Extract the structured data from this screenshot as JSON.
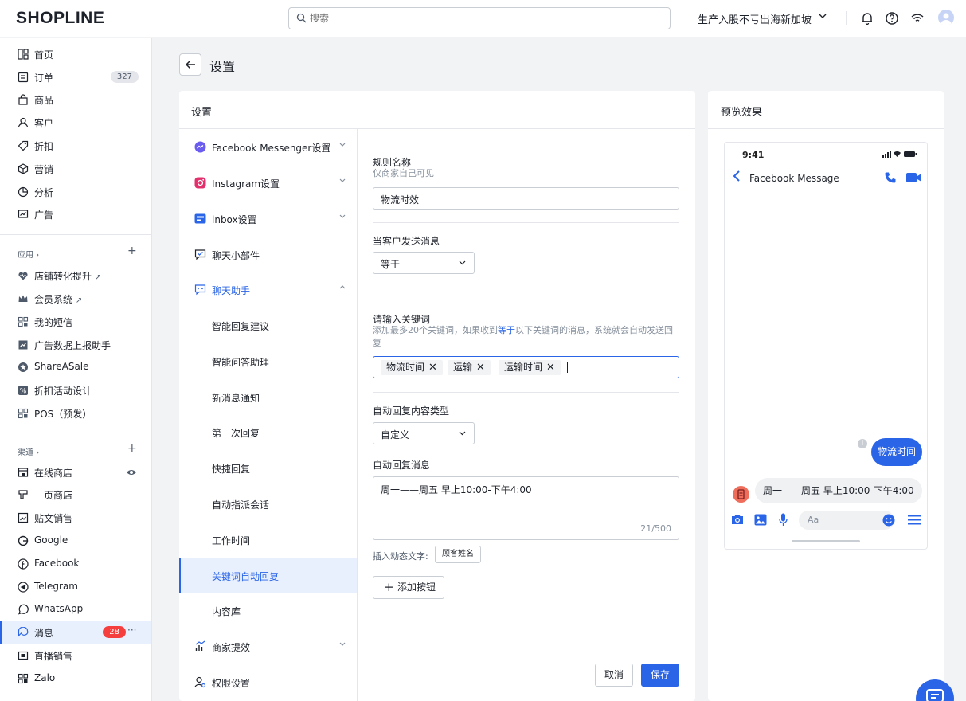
{
  "topbar": {
    "logo": "SHOPLINE",
    "search_placeholder": "搜索",
    "store_name": "生产入股不亏出海新加坡"
  },
  "sidebar": {
    "main": [
      {
        "label": "首页",
        "icon": "dashboard-icon"
      },
      {
        "label": "订单",
        "icon": "order-icon",
        "badge": "327"
      },
      {
        "label": "商品",
        "icon": "bag-icon"
      },
      {
        "label": "客户",
        "icon": "user-icon"
      },
      {
        "label": "折扣",
        "icon": "tag-icon"
      },
      {
        "label": "营销",
        "icon": "cube-icon"
      },
      {
        "label": "分析",
        "icon": "chart-icon"
      },
      {
        "label": "广告",
        "icon": "ads-icon"
      }
    ],
    "apps_heading": "应用",
    "apps": [
      {
        "label": "店铺转化提升",
        "icon": "heart-rate-icon"
      },
      {
        "label": "会员系统",
        "icon": "crown-icon"
      },
      {
        "label": "我的短信",
        "icon": "grid-icon"
      },
      {
        "label": "广告数据上报助手",
        "icon": "report-icon"
      },
      {
        "label": "ShareASale",
        "icon": "star-icon"
      },
      {
        "label": "折扣活动设计",
        "icon": "percent-icon"
      },
      {
        "label": "POS（预发）",
        "icon": "grid-icon"
      }
    ],
    "channels_heading": "渠道",
    "channels": [
      {
        "label": "在线商店",
        "icon": "store-icon"
      },
      {
        "label": "一页商店",
        "icon": "page-icon"
      },
      {
        "label": "贴文销售",
        "icon": "post-icon"
      },
      {
        "label": "Google",
        "icon": "google-icon"
      },
      {
        "label": "Facebook",
        "icon": "facebook-icon"
      },
      {
        "label": "Telegram",
        "icon": "telegram-icon"
      },
      {
        "label": "WhatsApp",
        "icon": "whatsapp-icon"
      },
      {
        "label": "消息",
        "icon": "message-icon",
        "badge": "28",
        "active": true
      },
      {
        "label": "直播销售",
        "icon": "live-icon"
      },
      {
        "label": "Zalo",
        "icon": "grid-icon"
      }
    ]
  },
  "page": {
    "title": "设置"
  },
  "settings": {
    "panel_title": "设置",
    "menu": [
      {
        "label": "Facebook Messenger设置"
      },
      {
        "label": "Instagram设置"
      },
      {
        "label": "inbox设置"
      },
      {
        "label": "聊天小部件"
      },
      {
        "label": "聊天助手"
      }
    ],
    "submenu": [
      {
        "label": "智能回复建议"
      },
      {
        "label": "智能问答助理"
      },
      {
        "label": "新消息通知"
      },
      {
        "label": "第一次回复"
      },
      {
        "label": "快捷回复"
      },
      {
        "label": "自动指派会话"
      },
      {
        "label": "工作时间"
      },
      {
        "label": "关键词自动回复"
      },
      {
        "label": "内容库"
      }
    ],
    "menu_tail": [
      {
        "label": "商家提效"
      },
      {
        "label": "权限设置"
      }
    ]
  },
  "form": {
    "rule_name_label": "规则名称",
    "rule_name_hint": "仅商家自己可见",
    "rule_name_value": "物流时效",
    "trigger_label": "当客户发送消息",
    "trigger_value": "等于",
    "keywords_label": "请输入关键词",
    "keywords_hint_a": "添加最多20个关键词，如果收到",
    "keywords_hint_link": "等于",
    "keywords_hint_b": "以下关键词的消息，系统就会自动发送回复",
    "keywords": [
      "物流时间",
      "运输",
      "运输时间"
    ],
    "reply_type_label": "自动回复内容类型",
    "reply_type_value": "自定义",
    "reply_msg_label": "自动回复消息",
    "reply_msg_value": "周一——周五 早上10:00-下午4:00",
    "reply_counter": "21/500",
    "insert_label": "插入动态文字:",
    "insert_chip": "顾客姓名",
    "add_button": "添加按钮",
    "cancel": "取消",
    "save": "保存"
  },
  "preview": {
    "title": "预览效果",
    "time": "9:41",
    "chat_title": "Facebook Message",
    "customer_msg": "物流时间",
    "bot_msg": "周一——周五 早上10:00-下午4:00",
    "input_placeholder": "Aa"
  },
  "colors": {
    "accent": "#2b65e7",
    "badge_red": "#f53f3f"
  }
}
